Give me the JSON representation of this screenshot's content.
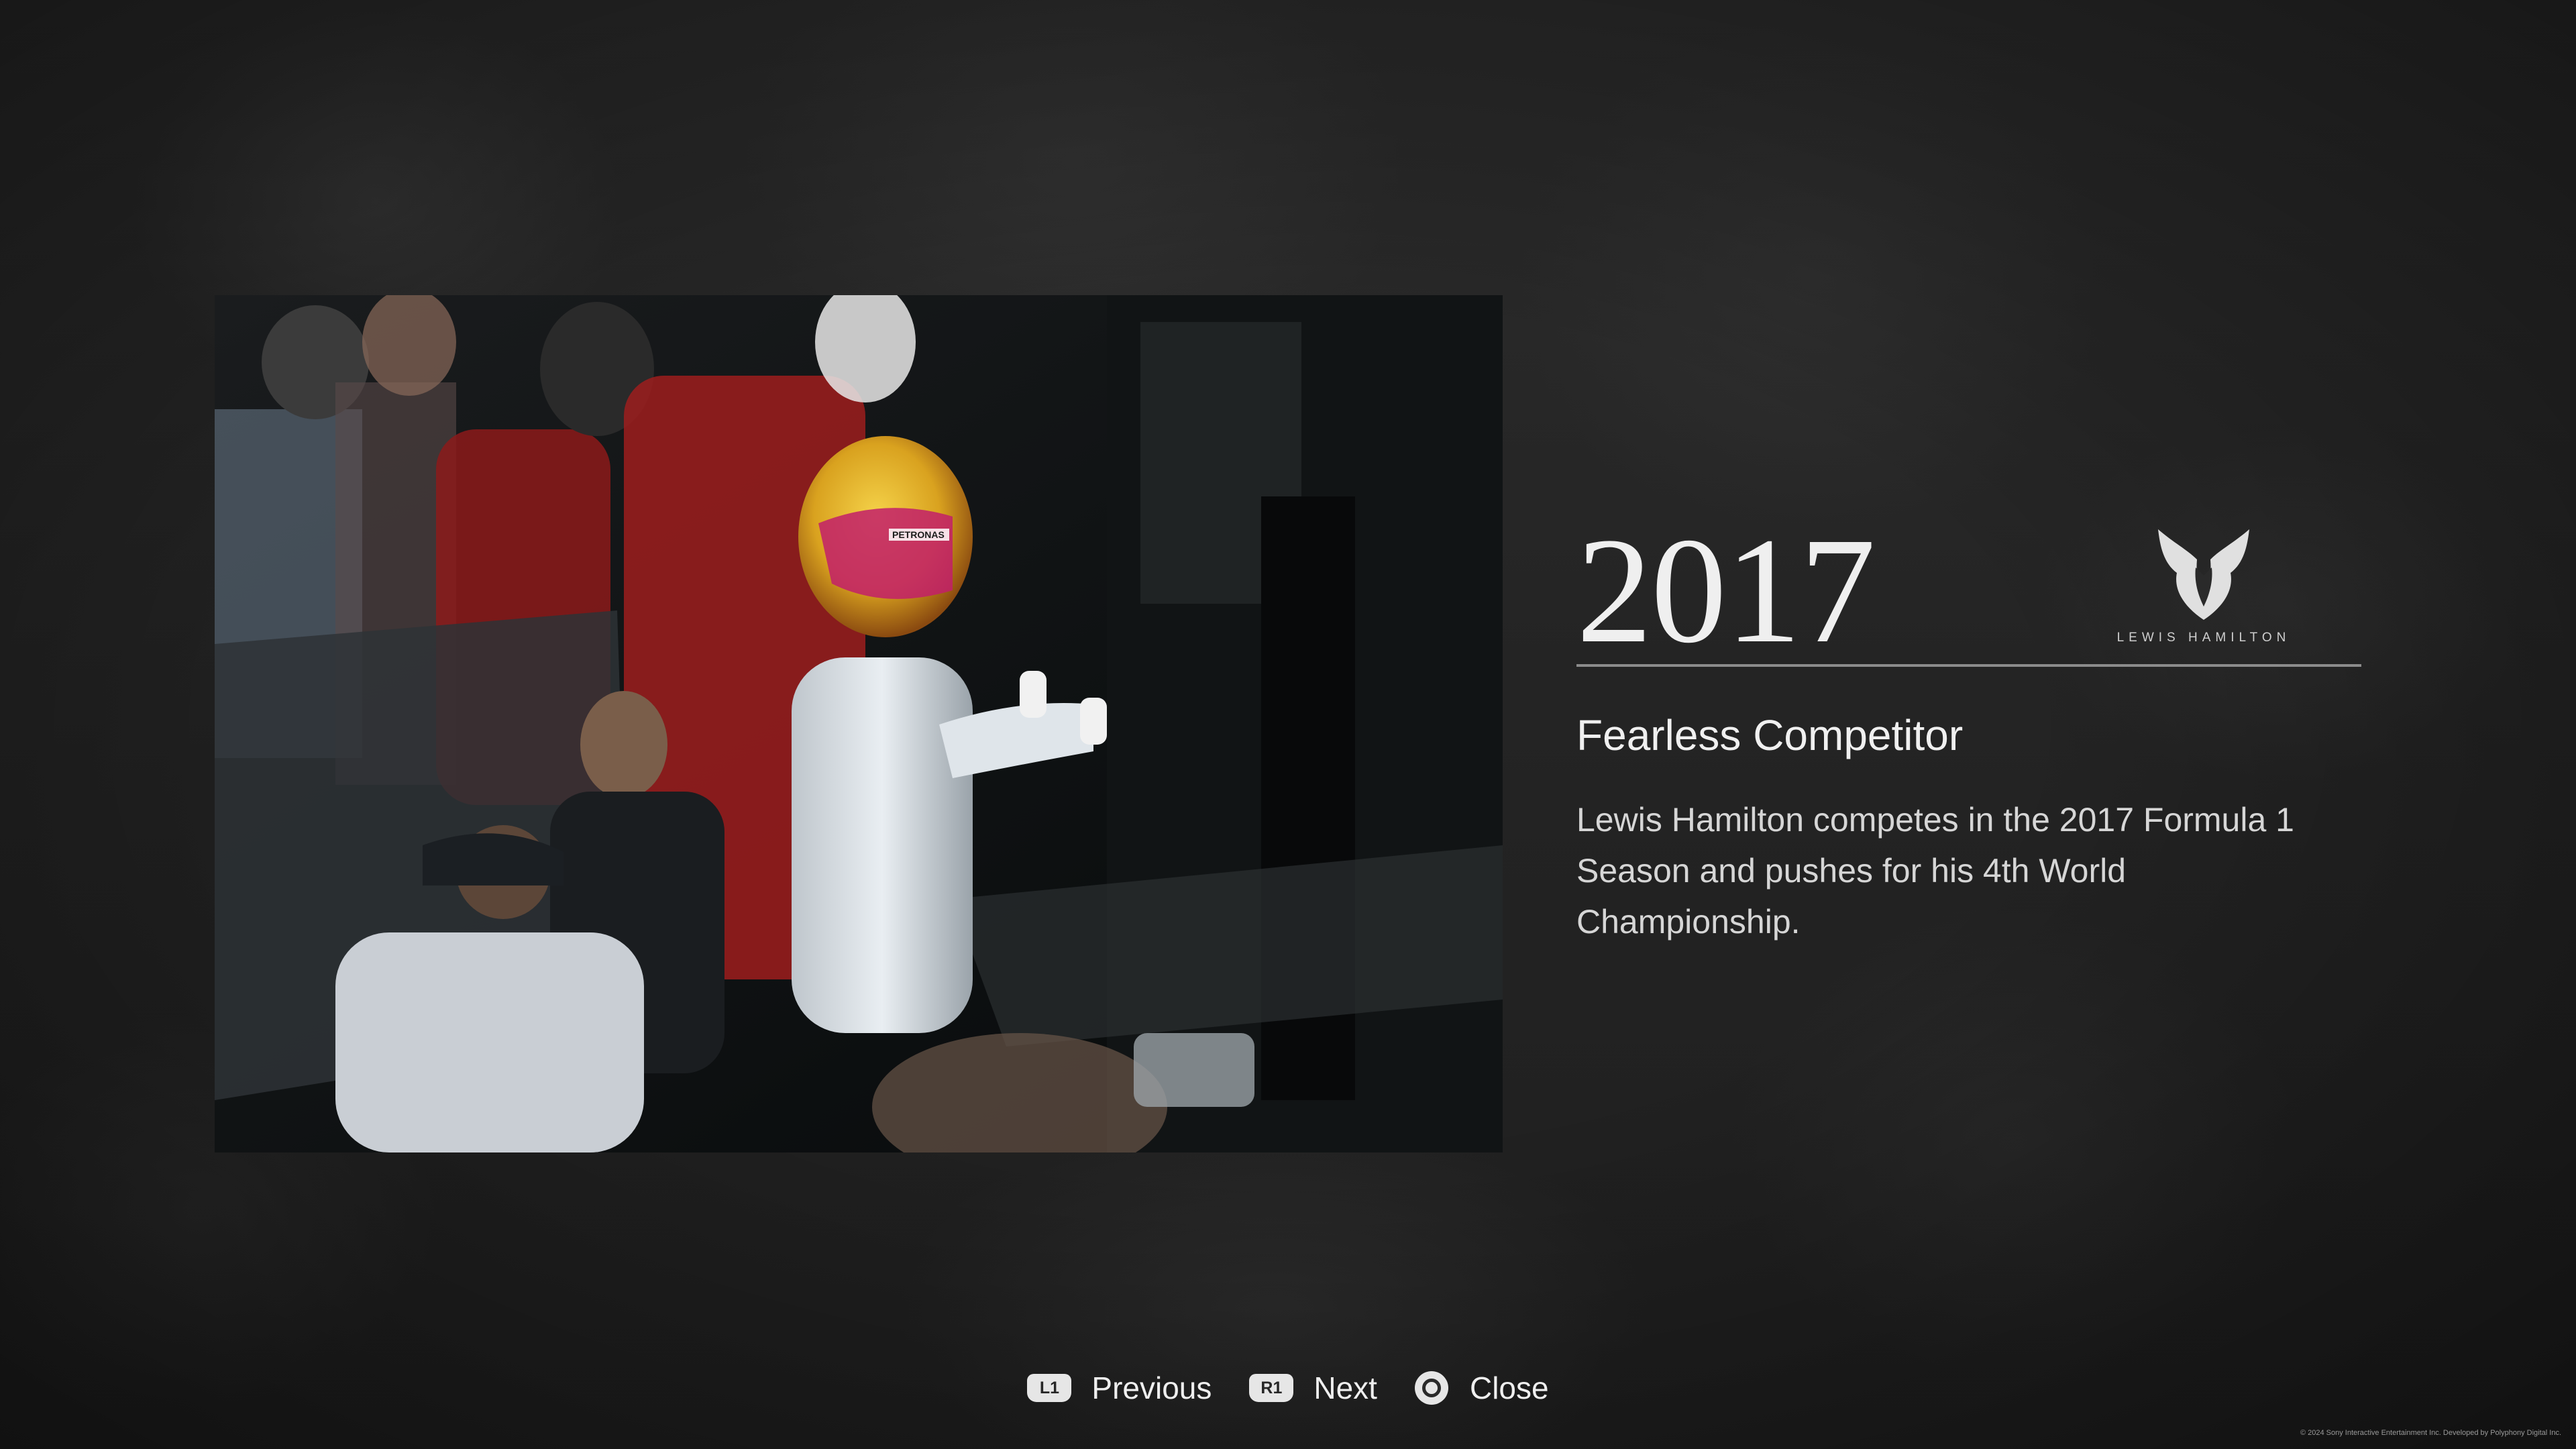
{
  "photo": {
    "description_icon": "photo-placeholder",
    "helmet_text": "PETRONAS"
  },
  "info": {
    "year": "2017",
    "brand_name": "LEWIS HAMILTON",
    "headline": "Fearless Competitor",
    "description": "Lewis Hamilton competes in the 2017 Formula 1 Season and pushes for his 4th World Championship."
  },
  "controls": {
    "previous": {
      "button": "L1",
      "label": "Previous"
    },
    "next": {
      "button": "R1",
      "label": "Next"
    },
    "close": {
      "button_icon": "circle-button-icon",
      "label": "Close"
    }
  },
  "footer": {
    "copyright": "© 2024 Sony Interactive Entertainment Inc. Developed by Polyphony Digital Inc."
  },
  "colors": {
    "background": "#262626",
    "text": "#efefef",
    "rule": "#8c8c8c"
  }
}
